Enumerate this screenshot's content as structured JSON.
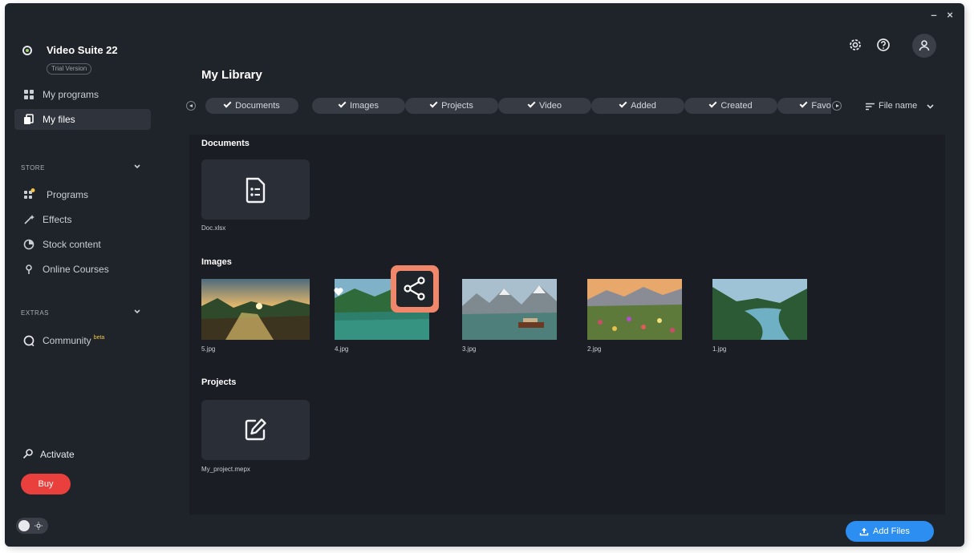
{
  "window": {
    "minimize": "–",
    "close": "×"
  },
  "app": {
    "name": "Video Suite 22",
    "badge": "Trial Version"
  },
  "sidebar": {
    "nav": [
      {
        "label": "My programs",
        "icon": "apps-grid-icon"
      },
      {
        "label": "My files",
        "icon": "files-icon",
        "active": true
      }
    ],
    "store_label": "STORE",
    "store_items": [
      {
        "label": "Programs",
        "icon": "programs-icon",
        "dot": true
      },
      {
        "label": "Effects",
        "icon": "effects-icon"
      },
      {
        "label": "Stock content",
        "icon": "stock-content-icon"
      },
      {
        "label": "Online Courses",
        "icon": "location-pin-icon"
      }
    ],
    "extras_label": "EXTRAS",
    "community": {
      "label": "Community",
      "badge": "beta"
    },
    "activate_label": "Activate",
    "buy_label": "Buy"
  },
  "header": {
    "icons": [
      "gear-icon",
      "help-icon",
      "profile-icon"
    ],
    "title": "My Library"
  },
  "filters": {
    "chips": [
      "Documents",
      "Images",
      "Projects",
      "Video",
      "Added",
      "Created",
      "Favorites"
    ],
    "sort_label": "File name"
  },
  "library": {
    "documents": {
      "title": "Documents",
      "files": [
        "Doc.xlsx"
      ]
    },
    "images": {
      "title": "Images",
      "files": [
        "5.jpg",
        "4.jpg",
        "3.jpg",
        "2.jpg",
        "1.jpg"
      ],
      "favorite": "4.jpg"
    },
    "projects": {
      "title": "Projects",
      "files": [
        "My_project.mepx"
      ]
    }
  },
  "actions": {
    "add_files": "Add Files"
  },
  "colors": {
    "window_bg": "#1f232a",
    "content_bg": "#1a1d23",
    "accent_blue": "#2b8ef0",
    "buy_red": "#e9403d",
    "highlight_orange": "#f0876b"
  }
}
